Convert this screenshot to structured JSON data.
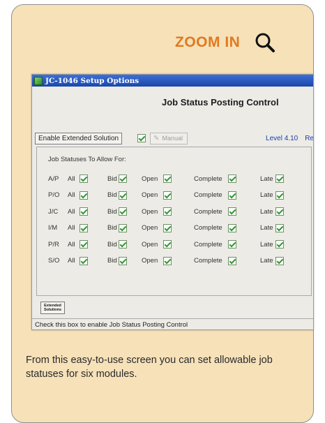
{
  "panel": {
    "zoom_label": "ZOOM IN",
    "caption": "From this easy-to-use screen you can set allowable job statuses for six modules.",
    "accent_color": "#e07a1f",
    "background_color": "#f6e1b9"
  },
  "window": {
    "title": "JC-1046 Setup Options",
    "heading": "Job Status Posting Control",
    "enable_label": "Enable Extended Solution",
    "enable_checked": true,
    "manual_label": "Manual",
    "level": "Level 4.10",
    "release": "Re",
    "group_title": "Job Statuses To Allow For:",
    "extended_button": "Extended Solutions",
    "status_text": "Check this box to enable Job Status Posting Control"
  },
  "rows": [
    {
      "module": "A/P",
      "all": "All",
      "bid": "Bid",
      "open": "Open",
      "complete": "Complete",
      "late": "Late"
    },
    {
      "module": "P/O",
      "all": "All",
      "bid": "Bid",
      "open": "Open",
      "complete": "Complete",
      "late": "Late"
    },
    {
      "module": "J/C",
      "all": "All",
      "bid": "Bid",
      "open": "Open",
      "complete": "Complete",
      "late": "Late"
    },
    {
      "module": "I/M",
      "all": "All",
      "bid": "Bid",
      "open": "Open",
      "complete": "Complete",
      "late": "Late"
    },
    {
      "module": "P/R",
      "all": "All",
      "bid": "Bid",
      "open": "Open",
      "complete": "Complete",
      "late": "Late"
    },
    {
      "module": "S/O",
      "all": "All",
      "bid": "Bid",
      "open": "Open",
      "complete": "Complete",
      "late": "Late"
    }
  ]
}
